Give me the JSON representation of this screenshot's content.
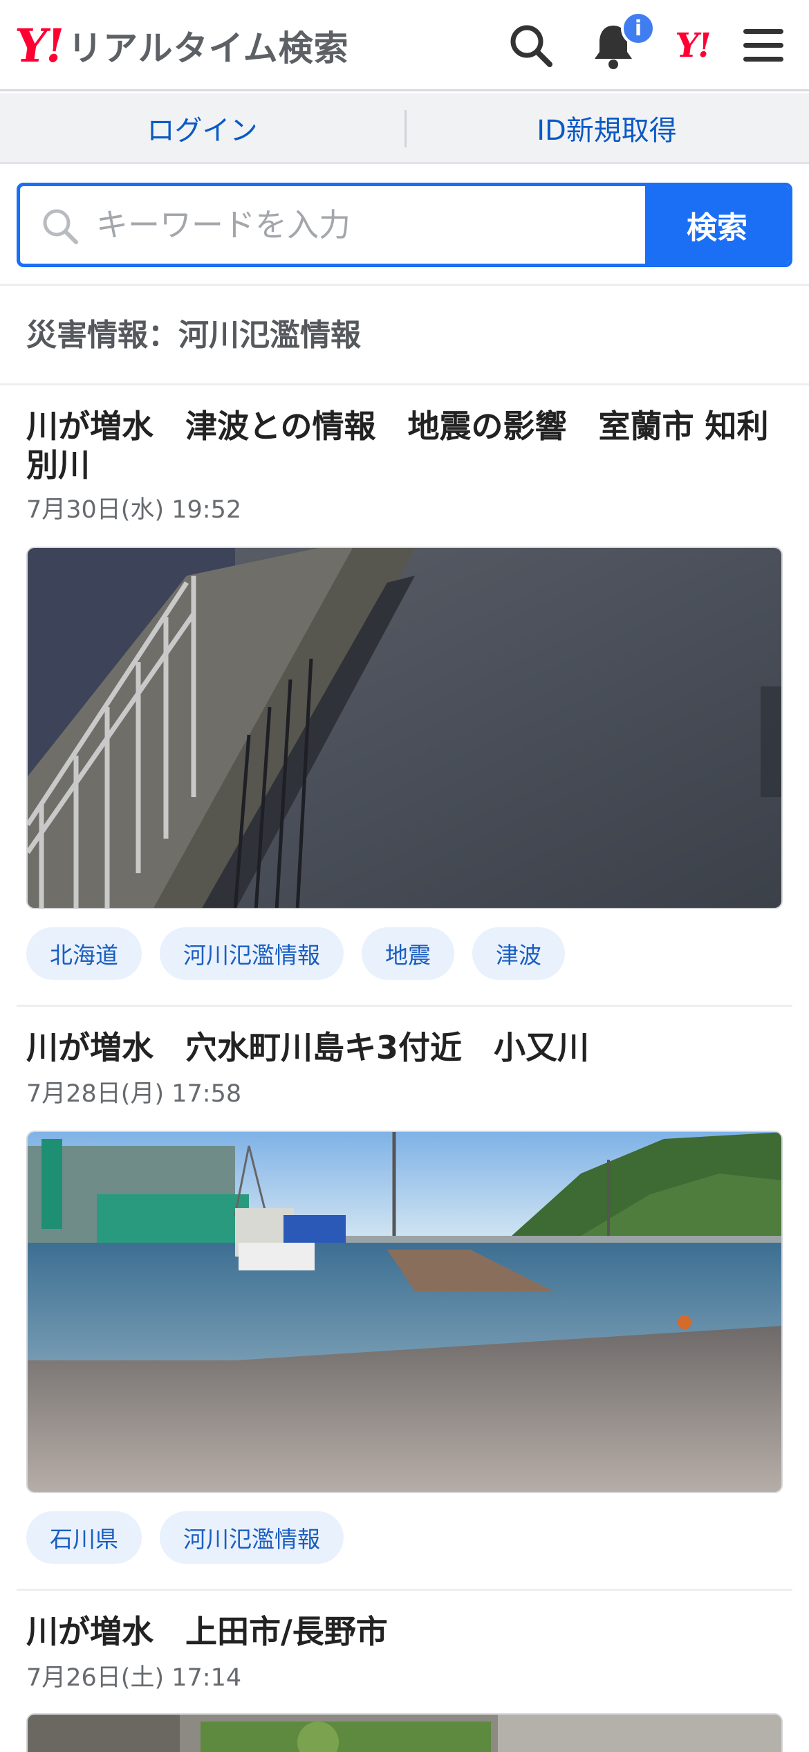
{
  "header": {
    "logo_mark": "Y!",
    "logo_text": "リアルタイム検索",
    "notification_badge": "i",
    "yahoo_japan_mark": "Y!",
    "icons": [
      "search-icon",
      "bell-icon",
      "yahoo-japan-icon",
      "hamburger-menu-icon"
    ]
  },
  "loginbar": {
    "login_label": "ログイン",
    "register_label": "ID新規取得"
  },
  "search": {
    "placeholder": "キーワードを入力",
    "button_label": "検索"
  },
  "section": {
    "title": "災害情報：河川氾濫情報"
  },
  "articles": [
    {
      "title": "川が増水　津波との情報　地震の影響　室蘭市 知利別川",
      "date": "7月30日(水) 19:52",
      "image": "flooded-riverside-walkway-with-railing",
      "tags": [
        "北海道",
        "河川氾濫情報",
        "地震",
        "津波"
      ]
    },
    {
      "title": "川が増水　穴水町川島キ3付近　小又川",
      "date": "7月28日(月) 17:58",
      "image": "flooded-road-near-river-with-truck-and-crane",
      "tags": [
        "石川県",
        "河川氾濫情報"
      ]
    },
    {
      "title": "川が増水　上田市/長野市",
      "date": "7月26日(土) 17:14",
      "image": "river-with-greenery",
      "tags": []
    }
  ],
  "colors": {
    "brand_red": "#ff0033",
    "accent_blue": "#1a6ff5",
    "link_blue": "#0a59c6",
    "tag_bg": "#e9f1fc"
  }
}
